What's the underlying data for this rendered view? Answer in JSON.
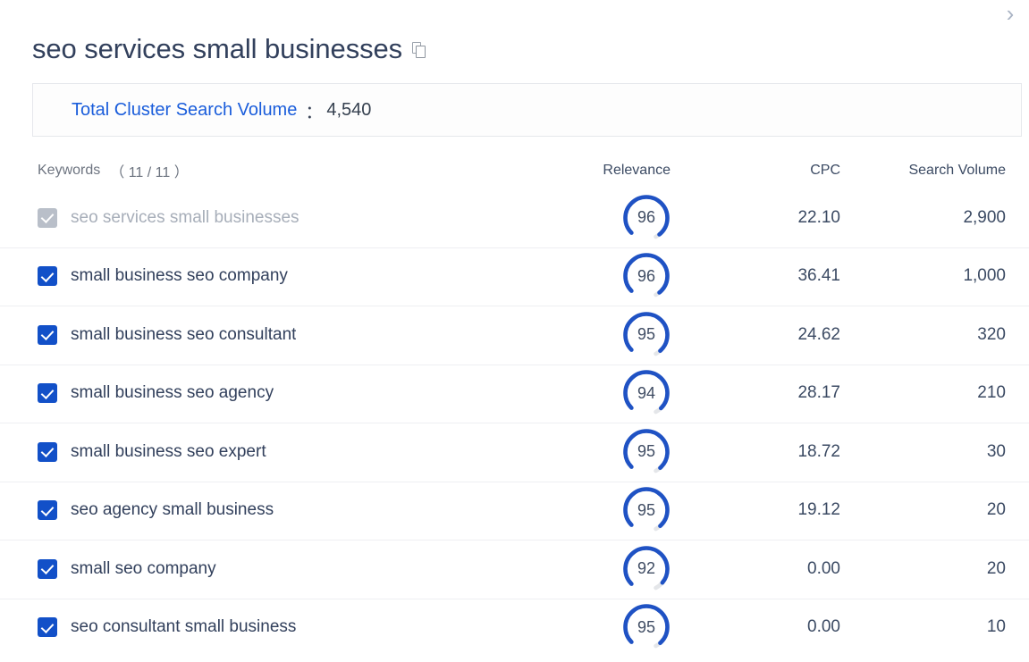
{
  "topbar": {
    "chevron_icon": "chevron-right-icon",
    "chevron_glyph": "›"
  },
  "header": {
    "title": "seo services small businesses",
    "copy_icon": "copy-icon"
  },
  "summary": {
    "label": "Total Cluster Search Volume",
    "separator": "：",
    "value": "4,540"
  },
  "table": {
    "columns": {
      "keywords": "Keywords",
      "keywords_count": "（ 11 / 11 ）",
      "relevance": "Relevance",
      "cpc": "CPC",
      "search_volume": "Search Volume"
    },
    "rows": [
      {
        "keyword": "seo services small businesses",
        "checked": true,
        "disabled": true,
        "relevance": 96,
        "cpc": "22.10",
        "search_volume": "2,900"
      },
      {
        "keyword": "small business seo company",
        "checked": true,
        "disabled": false,
        "relevance": 96,
        "cpc": "36.41",
        "search_volume": "1,000"
      },
      {
        "keyword": "small business seo consultant",
        "checked": true,
        "disabled": false,
        "relevance": 95,
        "cpc": "24.62",
        "search_volume": "320"
      },
      {
        "keyword": "small business seo agency",
        "checked": true,
        "disabled": false,
        "relevance": 94,
        "cpc": "28.17",
        "search_volume": "210"
      },
      {
        "keyword": "small business seo expert",
        "checked": true,
        "disabled": false,
        "relevance": 95,
        "cpc": "18.72",
        "search_volume": "30"
      },
      {
        "keyword": "seo agency small business",
        "checked": true,
        "disabled": false,
        "relevance": 95,
        "cpc": "19.12",
        "search_volume": "20"
      },
      {
        "keyword": "small seo company",
        "checked": true,
        "disabled": false,
        "relevance": 92,
        "cpc": "0.00",
        "search_volume": "20"
      },
      {
        "keyword": "seo consultant small business",
        "checked": true,
        "disabled": false,
        "relevance": 95,
        "cpc": "0.00",
        "search_volume": "10"
      }
    ]
  },
  "colors": {
    "accent_blue": "#1250c8",
    "link_blue": "#1a5ddb",
    "text_dark": "#32405c",
    "text_muted": "#6d7480",
    "disabled_grey": "#b9bfc9",
    "divider": "#eeeff2",
    "gauge_track": "#e4e6e9",
    "gauge_fill": "#1f52c4"
  }
}
